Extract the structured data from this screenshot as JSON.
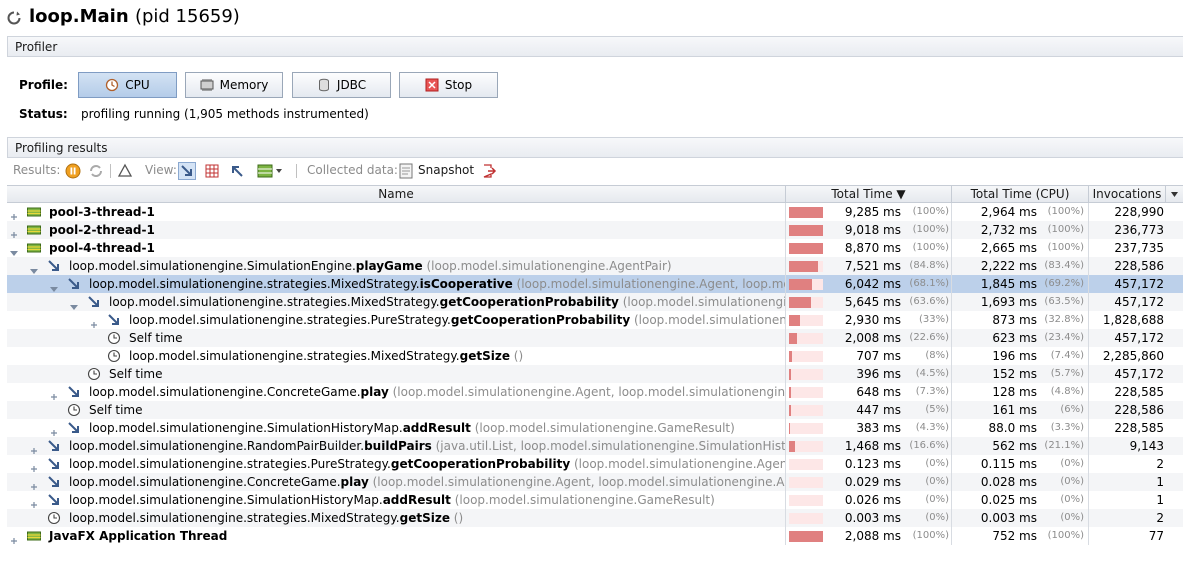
{
  "window": {
    "app_name": "loop.Main",
    "pid_label": "(pid 15659)"
  },
  "profiler": {
    "section_title": "Profiler",
    "profile_label": "Profile:",
    "buttons": {
      "cpu": "CPU",
      "memory": "Memory",
      "jdbc": "JDBC",
      "stop": "Stop"
    },
    "status_label": "Status:",
    "status_text": "profiling running (1,905 methods instrumented)"
  },
  "results": {
    "section_title": "Profiling results",
    "toolbar": {
      "results_label": "Results:",
      "view_label": "View:",
      "collected_label": "Collected data:",
      "snapshot_label": "Snapshot"
    },
    "columns": {
      "name": "Name",
      "total_time": "Total Time ▼",
      "total_time_cpu": "Total Time (CPU)",
      "invocations": "Invocations"
    },
    "rows": [
      {
        "name": "pool-3-thread-1",
        "method": "",
        "args": "",
        "time": "9,285 ms",
        "time_pct": "(100%)",
        "cpu": "2,964 ms",
        "cpu_pct": "(100%)",
        "inv": "228,990",
        "frac": 1.0
      },
      {
        "name": "pool-2-thread-1",
        "method": "",
        "args": "",
        "time": "9,018 ms",
        "time_pct": "(100%)",
        "cpu": "2,732 ms",
        "cpu_pct": "(100%)",
        "inv": "236,773",
        "frac": 1.0
      },
      {
        "name": "pool-4-thread-1",
        "method": "",
        "args": "",
        "time": "8,870 ms",
        "time_pct": "(100%)",
        "cpu": "2,665 ms",
        "cpu_pct": "(100%)",
        "inv": "237,735",
        "frac": 1.0
      },
      {
        "name": "loop.model.simulationengine.SimulationEngine.",
        "method": "playGame",
        "args": "(loop.model.simulationengine.AgentPair)",
        "time": "7,521 ms",
        "time_pct": "(84.8%)",
        "cpu": "2,222 ms",
        "cpu_pct": "(83.4%)",
        "inv": "228,586",
        "frac": 0.848
      },
      {
        "name": "loop.model.simulationengine.strategies.MixedStrategy.",
        "method": "isCooperative",
        "args": "(loop.model.simulationengine.Agent, loop.model.si",
        "time": "6,042 ms",
        "time_pct": "(68.1%)",
        "cpu": "1,845 ms",
        "cpu_pct": "(69.2%)",
        "inv": "457,172",
        "frac": 0.681
      },
      {
        "name": "loop.model.simulationengine.strategies.MixedStrategy.",
        "method": "getCooperationProbability",
        "args": "(loop.model.simulationengine.Age",
        "time": "5,645 ms",
        "time_pct": "(63.6%)",
        "cpu": "1,693 ms",
        "cpu_pct": "(63.5%)",
        "inv": "457,172",
        "frac": 0.636
      },
      {
        "name": "loop.model.simulationengine.strategies.PureStrategy.",
        "method": "getCooperationProbability",
        "args": "(loop.model.simulationengine.A",
        "time": "2,930 ms",
        "time_pct": "(33%)",
        "cpu": "873 ms",
        "cpu_pct": "(32.8%)",
        "inv": "1,828,688",
        "frac": 0.33
      },
      {
        "name": "Self time",
        "method": "",
        "args": "",
        "time": "2,008 ms",
        "time_pct": "(22.6%)",
        "cpu": "623 ms",
        "cpu_pct": "(23.4%)",
        "inv": "457,172",
        "frac": 0.226
      },
      {
        "name": "loop.model.simulationengine.strategies.MixedStrategy.",
        "method": "getSize",
        "args": "()",
        "time": "707 ms",
        "time_pct": "(8%)",
        "cpu": "196 ms",
        "cpu_pct": "(7.4%)",
        "inv": "2,285,860",
        "frac": 0.08
      },
      {
        "name": "Self time",
        "method": "",
        "args": "",
        "time": "396 ms",
        "time_pct": "(4.5%)",
        "cpu": "152 ms",
        "cpu_pct": "(5.7%)",
        "inv": "457,172",
        "frac": 0.045
      },
      {
        "name": "loop.model.simulationengine.ConcreteGame.",
        "method": "play",
        "args": "(loop.model.simulationengine.Agent, loop.model.simulationengine.Agen",
        "time": "648 ms",
        "time_pct": "(7.3%)",
        "cpu": "128 ms",
        "cpu_pct": "(4.8%)",
        "inv": "228,585",
        "frac": 0.073
      },
      {
        "name": "Self time",
        "method": "",
        "args": "",
        "time": "447 ms",
        "time_pct": "(5%)",
        "cpu": "161 ms",
        "cpu_pct": "(6%)",
        "inv": "228,586",
        "frac": 0.05
      },
      {
        "name": "loop.model.simulationengine.SimulationHistoryMap.",
        "method": "addResult",
        "args": "(loop.model.simulationengine.GameResult)",
        "time": "383 ms",
        "time_pct": "(4.3%)",
        "cpu": "88.0 ms",
        "cpu_pct": "(3.3%)",
        "inv": "228,585",
        "frac": 0.043
      },
      {
        "name": "loop.model.simulationengine.RandomPairBuilder.",
        "method": "buildPairs",
        "args": "(java.util.List, loop.model.simulationengine.SimulationHistory)",
        "time": "1,468 ms",
        "time_pct": "(16.6%)",
        "cpu": "562 ms",
        "cpu_pct": "(21.1%)",
        "inv": "9,143",
        "frac": 0.166
      },
      {
        "name": "loop.model.simulationengine.strategies.PureStrategy.",
        "method": "getCooperationProbability",
        "args": "(loop.model.simulationengine.Agent, loop",
        "time": "0.123 ms",
        "time_pct": "(0%)",
        "cpu": "0.115 ms",
        "cpu_pct": "(0%)",
        "inv": "2",
        "frac": 0.0
      },
      {
        "name": "loop.model.simulationengine.ConcreteGame.",
        "method": "play",
        "args": "(loop.model.simulationengine.Agent, loop.model.simulationengine.Agent, b",
        "time": "0.029 ms",
        "time_pct": "(0%)",
        "cpu": "0.028 ms",
        "cpu_pct": "(0%)",
        "inv": "1",
        "frac": 0.0
      },
      {
        "name": "loop.model.simulationengine.SimulationHistoryMap.",
        "method": "addResult",
        "args": "(loop.model.simulationengine.GameResult)",
        "time": "0.026 ms",
        "time_pct": "(0%)",
        "cpu": "0.025 ms",
        "cpu_pct": "(0%)",
        "inv": "1",
        "frac": 0.0
      },
      {
        "name": "loop.model.simulationengine.strategies.MixedStrategy.",
        "method": "getSize",
        "args": "()",
        "time": "0.003 ms",
        "time_pct": "(0%)",
        "cpu": "0.003 ms",
        "cpu_pct": "(0%)",
        "inv": "2",
        "frac": 0.0
      },
      {
        "name": "JavaFX Application Thread",
        "method": "",
        "args": "",
        "time": "2,088 ms",
        "time_pct": "(100%)",
        "cpu": "752 ms",
        "cpu_pct": "(100%)",
        "inv": "77",
        "frac": 1.0
      }
    ]
  },
  "colors": {
    "bar": "#e08080",
    "bar_bg": "#fde7e7",
    "selection": "#bcd0ea",
    "accent_blue": "#4a6ea8"
  },
  "icons": {
    "thread": "thread-icon",
    "method": "method-icon",
    "self_time": "clock-icon"
  }
}
